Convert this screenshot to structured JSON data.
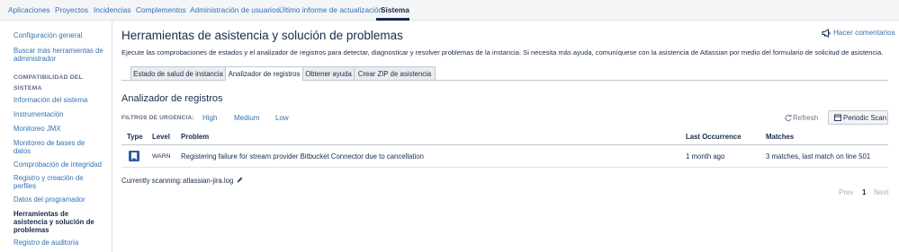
{
  "topnav": {
    "items": [
      {
        "label": "Aplicaciones"
      },
      {
        "label": "Proyectos"
      },
      {
        "label": "Incidencias"
      },
      {
        "label": "Complementos"
      },
      {
        "label": "Administración de usuarios"
      },
      {
        "label": "Último informe de actualización"
      },
      {
        "label": "Sistema"
      }
    ]
  },
  "sidebar": {
    "items": [
      {
        "label": "Configuración general"
      },
      {
        "label": "Buscar más herramientas de administrador"
      }
    ],
    "section_heading": "COMPATIBILIDAD DEL SISTEMA",
    "section_items": [
      {
        "label": "Información del sistema"
      },
      {
        "label": "Instrumentación"
      },
      {
        "label": "Monitoreo JMX"
      },
      {
        "label": "Monitoreo de bases de datos"
      },
      {
        "label": "Comprobación de integridad"
      },
      {
        "label": "Registro y creación de perfiles"
      },
      {
        "label": "Datos del programador"
      },
      {
        "label": "Herramientas de asistencia y solución de problemas"
      },
      {
        "label": "Registro de auditoría"
      }
    ]
  },
  "main": {
    "title": "Herramientas de asistencia y solución de problemas",
    "feedback_label": "Hacer comentarios",
    "description": "Ejecute las comprobaciones de estados y el analizador de registros para detectar, diagnosticar y resolver problemas de la instancia. Si necesita más ayuda, comuníquese con la asistencia de Atlassian por medio del formulario de solicitud de asistencia.",
    "tabs": [
      {
        "label": "Estado de salud de instancia"
      },
      {
        "label": "Analizador de registros"
      },
      {
        "label": "Obtener ayuda"
      },
      {
        "label": "Crear ZIP de asistencia"
      }
    ],
    "active_tab_index": 1
  },
  "analyzer": {
    "heading": "Analizador de registros",
    "filter_label": "FILTROS DE URGENCIA:",
    "filters": [
      "High",
      "Medium",
      "Low"
    ],
    "refresh_label": "Refresh",
    "periodic_scan_label": "Periodic Scan",
    "table": {
      "headers": [
        "Type",
        "Level",
        "Problem",
        "Last Occurrence",
        "Matches"
      ],
      "rows": [
        {
          "type_icon": "bookmark-icon",
          "level": "WARN",
          "problem": "Registering failure for stream provider Bitbucket Connector due to cancellation",
          "last_occurrence": "1 month ago",
          "matches": "3 matches, last match on line 501"
        }
      ]
    },
    "scanning_label": "Currently scanning:",
    "scanning_file": "atlassian-jira.log",
    "pagination": {
      "prev": "Prev",
      "current": "1",
      "next": "Next"
    }
  },
  "colors": {
    "link": "#3572b0",
    "text": "#172b4d",
    "nav_bg": "#f4f5f7",
    "type_icon": "#2d5fa3"
  }
}
